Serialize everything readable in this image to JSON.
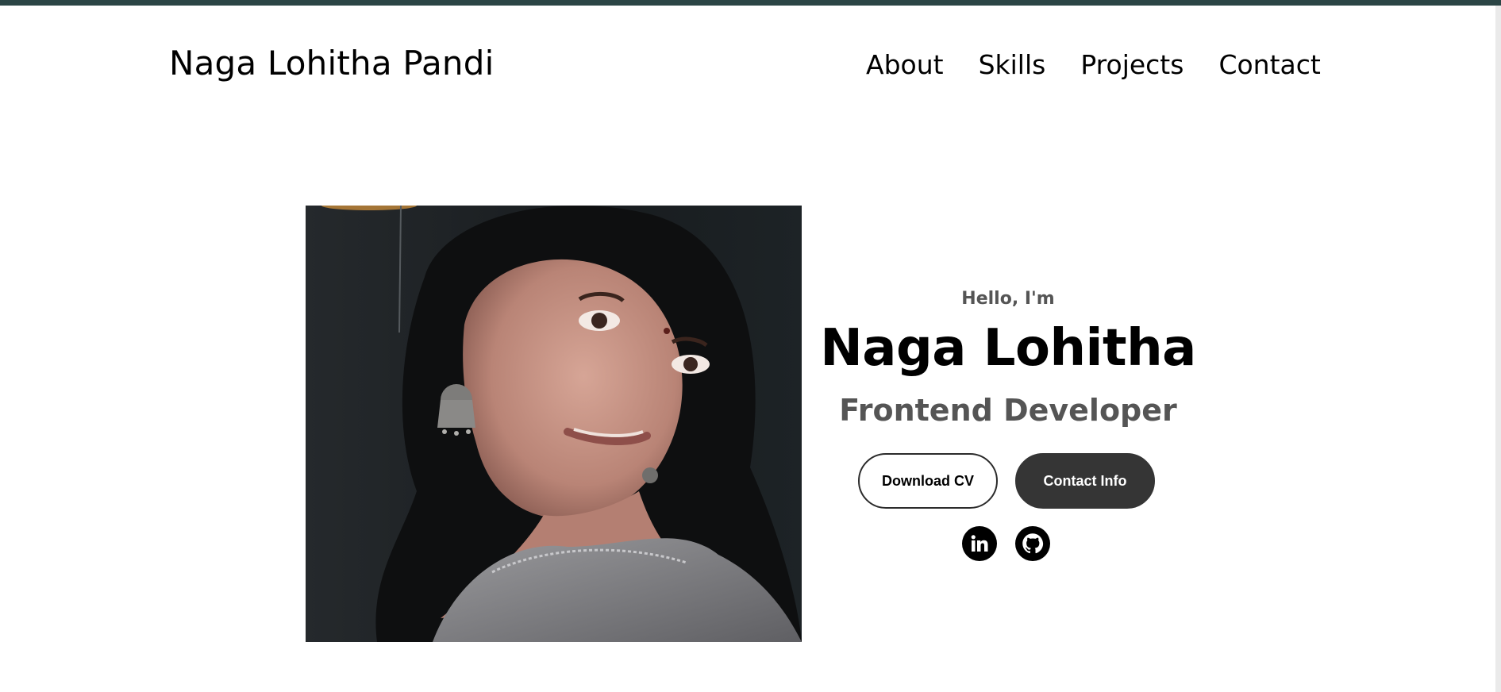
{
  "header": {
    "logo": "Naga Lohitha Pandi",
    "nav": [
      {
        "label": "About"
      },
      {
        "label": "Skills"
      },
      {
        "label": "Projects"
      },
      {
        "label": "Contact"
      }
    ]
  },
  "hero": {
    "greeting": "Hello, I'm",
    "name": "Naga Lohitha",
    "title": "Frontend Developer",
    "download_cv_label": "Download CV",
    "contact_info_label": "Contact Info",
    "socials": [
      {
        "icon": "linkedin-icon"
      },
      {
        "icon": "github-icon"
      }
    ]
  },
  "colors": {
    "top_strip": "#2b4545",
    "primary_text": "#000000",
    "secondary_text": "#555555",
    "button_dark": "#353535",
    "page_background": "#ffffff"
  }
}
